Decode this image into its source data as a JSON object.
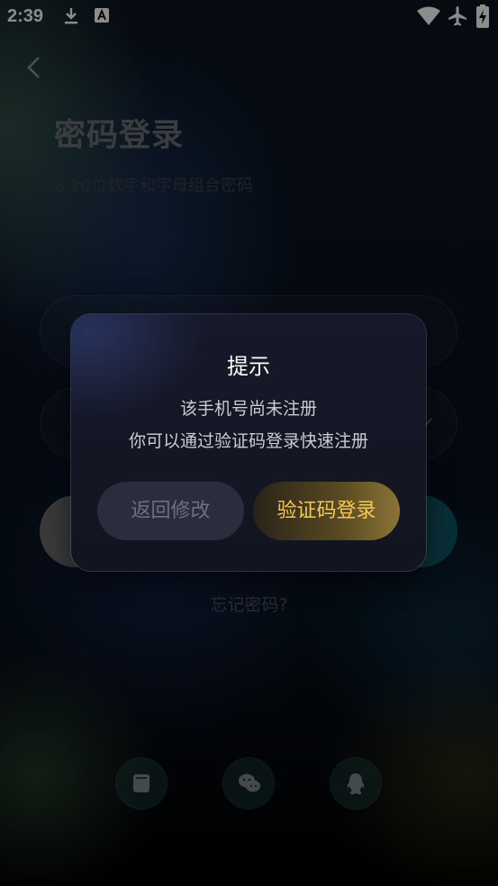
{
  "status_bar": {
    "time": "2:39",
    "icons": [
      "download-icon",
      "font-icon",
      "wifi-icon",
      "airplane-icon",
      "battery-charging-icon"
    ]
  },
  "page": {
    "title": "密码登录",
    "subtitle": "8-20位数字和字母组合密码",
    "forgot_password": "忘记密码?",
    "social_logins": [
      "phone-icon",
      "wechat-icon",
      "qq-icon"
    ]
  },
  "dialog": {
    "title": "提示",
    "message_line1": "该手机号尚未注册",
    "message_line2": "你可以通过验证码登录快速注册",
    "cancel_label": "返回修改",
    "confirm_label": "验证码登录"
  },
  "colors": {
    "confirm_text": "#f3c95a",
    "cancel_text": "#6c7080",
    "dialog_bg": "#12141f"
  }
}
